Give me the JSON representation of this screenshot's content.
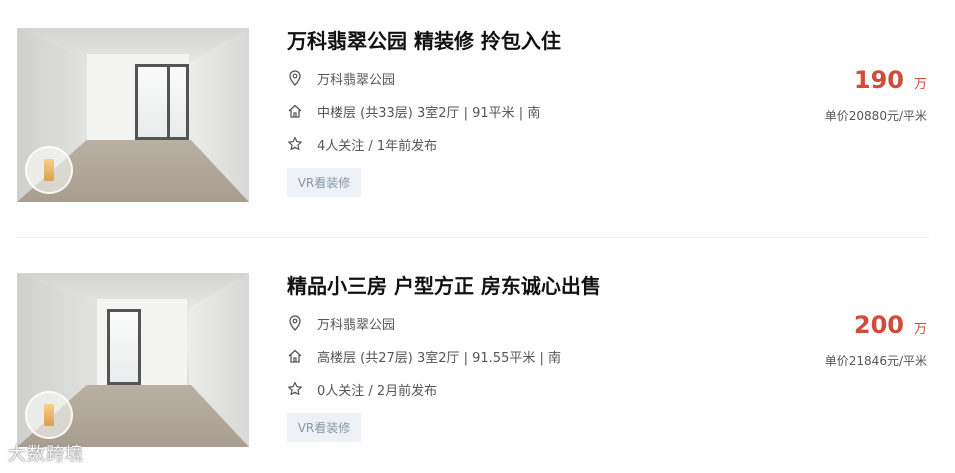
{
  "listings": [
    {
      "title": "万科翡翠公园 精装修 拎包入住",
      "community": "万科翡翠公园",
      "details": "中楼层 (共33层) 3室2厅 | 91平米 | 南",
      "followers": "4人关注 / 1年前发布",
      "vr_button": "VR看装修",
      "price": "190",
      "price_unit": "万",
      "unit_price": "单价20880元/平米"
    },
    {
      "title": "精品小三房 户型方正 房东诚心出售",
      "community": "万科翡翠公园",
      "details": "高楼层 (共27层) 3室2厅 | 91.55平米 | 南",
      "followers": "0人关注 / 2月前发布",
      "vr_button": "VR看装修",
      "price": "200",
      "price_unit": "万",
      "unit_price": "单价21846元/平米"
    }
  ],
  "watermark": "大数跨境",
  "colors": {
    "price": "#d14b3a",
    "vr_button_bg": "#eef2f6",
    "vr_button_text": "#8696a6"
  },
  "icons": [
    "location-pin-icon",
    "house-icon",
    "star-icon",
    "vr-badge-icon"
  ]
}
